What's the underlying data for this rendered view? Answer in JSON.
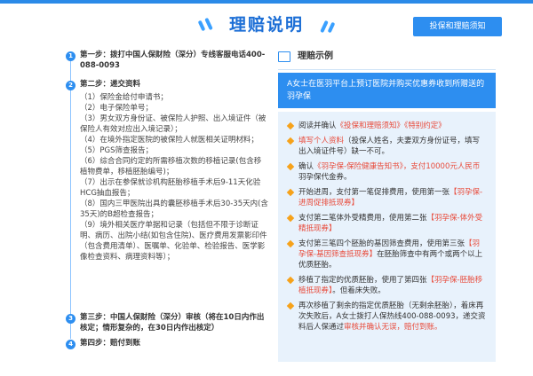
{
  "header": {
    "title": "理赔说明",
    "notice_button": "投保和理赔须知"
  },
  "left": {
    "step1": {
      "num": "1",
      "text": "第一步：拨打中国人保财险（深分）专线客服电话400-088-0093"
    },
    "step2": {
      "num": "2",
      "title": "第二步：递交资料",
      "lines": [
        "（1）保险金给付申请书；",
        "（2）电子保险单号；",
        "（3）男女双方身份证、被保险人护照、出入境证件（被保险人有效对应出入境记录）；",
        "（4）在境外指定医院的被保险人就医相关证明材料；",
        "（5）PGS筛查报告；",
        "（6）综合合同约定的所需移植次数的移植记录(包含移植物费单，移植胚胎编号)；",
        "（7）出示在参保就诊机构胚胎移植手术后9-11天化验HCG抽血报告；",
        "（8）国内三甲医院出具的囊胚移植手术后30-35天内(含35天)的B超检查报告；",
        "（9）境外相关医疗单据和记录（包括但不限于诊断证明、病历、出院小结(如包含住院)、医疗费用发票影印件（包含费用清单）、医嘱单、化验单、检验报告、医学影像检查资料、病理资料等）；"
      ]
    },
    "step3": {
      "num": "3",
      "text": "第三步：中国人保财险（深分）审核（将在10日内作出核定；情形复杂的，在30日内作出核定）"
    },
    "step4": {
      "num": "4",
      "text": "第四步：赔付到账"
    }
  },
  "right": {
    "title": "理赔示例",
    "case": "A女士在医羽平台上预订医院并购买优惠券收到所赠送的羽孕保",
    "items": [
      {
        "pre": "阅读并确认",
        "red": "《投保和理赔须知》《特别约定》",
        "post": ""
      },
      {
        "pre": "",
        "red": "填写个人资料",
        "post": "（投保人姓名，夫妻双方身份证号，填写出入境证件号）缺一不可。"
      },
      {
        "pre": "确认",
        "red": "《羽孕保-保险健康告知书》，支付10000元人民币",
        "post": "羽孕保代金券。"
      },
      {
        "pre": "开始进周，支付第一笔促排费用，使用第一张",
        "red": "【羽孕保-进周促排抵现券】",
        "post": ""
      },
      {
        "pre": "支付第二笔体外受精费用，使用第二张",
        "red": "【羽孕保-体外受精抵现券】",
        "post": ""
      },
      {
        "pre": "支付第三笔四个胚胎的基因筛查费用，使用第三张",
        "red": "【羽孕保-基因筛查抵现券】",
        "post": "在胚胎筛查中有两个或两个以上优质胚胎。"
      },
      {
        "pre": "移植了指定的优质胚胎，使用了第四张",
        "red": "【羽孕保-胚胎移植抵现券】",
        "post": "。但着床失败。"
      },
      {
        "pre": "再次移植了剩余的指定优质胚胎（无剩余胚胎），着床再次失败后，A女士拨打人保热线400-088-0093，递交资料后人保通过",
        "red": "审核并确认无误，赔付到账。",
        "post": ""
      }
    ]
  }
}
